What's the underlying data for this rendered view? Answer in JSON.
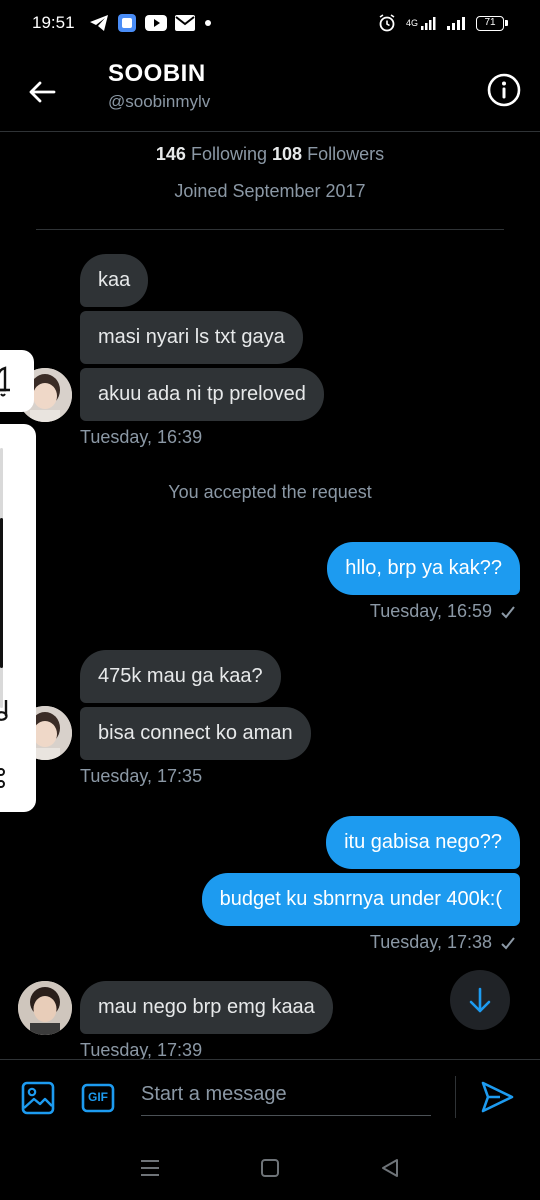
{
  "status_bar": {
    "time": "19:51",
    "network": "4G",
    "battery": "71"
  },
  "header": {
    "name": "SOOBIN",
    "handle": "@soobinmylv"
  },
  "profile": {
    "following_count": "146",
    "following_label": "Following",
    "followers_count": "108",
    "followers_label": "Followers",
    "joined": "Joined September 2017"
  },
  "conversation": {
    "group1": {
      "messages": [
        "kaa",
        "masi nyari ls txt gaya",
        "akuu ada ni tp preloved"
      ],
      "timestamp": "Tuesday, 16:39"
    },
    "system": "You accepted the request",
    "group2": {
      "messages": [
        "hllo, brp ya kak??"
      ],
      "timestamp": "Tuesday, 16:59"
    },
    "group3": {
      "messages": [
        "475k mau ga kaa?",
        "bisa connect ko aman"
      ],
      "timestamp": "Tuesday, 17:35"
    },
    "group4": {
      "messages": [
        "itu gabisa nego??",
        "budget ku sbnrnya under 400k:("
      ],
      "timestamp": "Tuesday, 17:38"
    },
    "group5": {
      "messages": [
        "mau nego brp emg kaaa"
      ],
      "timestamp": "Tuesday, 17:39"
    }
  },
  "composer": {
    "placeholder": "Start a message",
    "gif_label": "GIF"
  },
  "colors": {
    "accent": "#1d9bf0",
    "incoming_bubble": "#2f3336",
    "muted_text": "#8b98a5"
  }
}
